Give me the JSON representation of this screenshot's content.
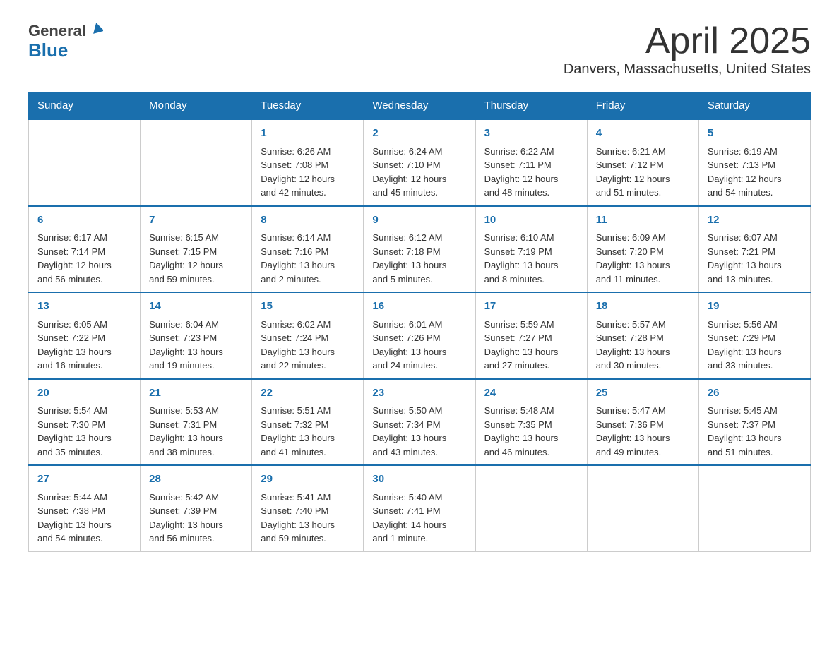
{
  "header": {
    "logo_general": "General",
    "logo_blue": "Blue",
    "title": "April 2025",
    "subtitle": "Danvers, Massachusetts, United States"
  },
  "days_of_week": [
    "Sunday",
    "Monday",
    "Tuesday",
    "Wednesday",
    "Thursday",
    "Friday",
    "Saturday"
  ],
  "weeks": [
    [
      {
        "day": "",
        "info": ""
      },
      {
        "day": "",
        "info": ""
      },
      {
        "day": "1",
        "info": "Sunrise: 6:26 AM\nSunset: 7:08 PM\nDaylight: 12 hours\nand 42 minutes."
      },
      {
        "day": "2",
        "info": "Sunrise: 6:24 AM\nSunset: 7:10 PM\nDaylight: 12 hours\nand 45 minutes."
      },
      {
        "day": "3",
        "info": "Sunrise: 6:22 AM\nSunset: 7:11 PM\nDaylight: 12 hours\nand 48 minutes."
      },
      {
        "day": "4",
        "info": "Sunrise: 6:21 AM\nSunset: 7:12 PM\nDaylight: 12 hours\nand 51 minutes."
      },
      {
        "day": "5",
        "info": "Sunrise: 6:19 AM\nSunset: 7:13 PM\nDaylight: 12 hours\nand 54 minutes."
      }
    ],
    [
      {
        "day": "6",
        "info": "Sunrise: 6:17 AM\nSunset: 7:14 PM\nDaylight: 12 hours\nand 56 minutes."
      },
      {
        "day": "7",
        "info": "Sunrise: 6:15 AM\nSunset: 7:15 PM\nDaylight: 12 hours\nand 59 minutes."
      },
      {
        "day": "8",
        "info": "Sunrise: 6:14 AM\nSunset: 7:16 PM\nDaylight: 13 hours\nand 2 minutes."
      },
      {
        "day": "9",
        "info": "Sunrise: 6:12 AM\nSunset: 7:18 PM\nDaylight: 13 hours\nand 5 minutes."
      },
      {
        "day": "10",
        "info": "Sunrise: 6:10 AM\nSunset: 7:19 PM\nDaylight: 13 hours\nand 8 minutes."
      },
      {
        "day": "11",
        "info": "Sunrise: 6:09 AM\nSunset: 7:20 PM\nDaylight: 13 hours\nand 11 minutes."
      },
      {
        "day": "12",
        "info": "Sunrise: 6:07 AM\nSunset: 7:21 PM\nDaylight: 13 hours\nand 13 minutes."
      }
    ],
    [
      {
        "day": "13",
        "info": "Sunrise: 6:05 AM\nSunset: 7:22 PM\nDaylight: 13 hours\nand 16 minutes."
      },
      {
        "day": "14",
        "info": "Sunrise: 6:04 AM\nSunset: 7:23 PM\nDaylight: 13 hours\nand 19 minutes."
      },
      {
        "day": "15",
        "info": "Sunrise: 6:02 AM\nSunset: 7:24 PM\nDaylight: 13 hours\nand 22 minutes."
      },
      {
        "day": "16",
        "info": "Sunrise: 6:01 AM\nSunset: 7:26 PM\nDaylight: 13 hours\nand 24 minutes."
      },
      {
        "day": "17",
        "info": "Sunrise: 5:59 AM\nSunset: 7:27 PM\nDaylight: 13 hours\nand 27 minutes."
      },
      {
        "day": "18",
        "info": "Sunrise: 5:57 AM\nSunset: 7:28 PM\nDaylight: 13 hours\nand 30 minutes."
      },
      {
        "day": "19",
        "info": "Sunrise: 5:56 AM\nSunset: 7:29 PM\nDaylight: 13 hours\nand 33 minutes."
      }
    ],
    [
      {
        "day": "20",
        "info": "Sunrise: 5:54 AM\nSunset: 7:30 PM\nDaylight: 13 hours\nand 35 minutes."
      },
      {
        "day": "21",
        "info": "Sunrise: 5:53 AM\nSunset: 7:31 PM\nDaylight: 13 hours\nand 38 minutes."
      },
      {
        "day": "22",
        "info": "Sunrise: 5:51 AM\nSunset: 7:32 PM\nDaylight: 13 hours\nand 41 minutes."
      },
      {
        "day": "23",
        "info": "Sunrise: 5:50 AM\nSunset: 7:34 PM\nDaylight: 13 hours\nand 43 minutes."
      },
      {
        "day": "24",
        "info": "Sunrise: 5:48 AM\nSunset: 7:35 PM\nDaylight: 13 hours\nand 46 minutes."
      },
      {
        "day": "25",
        "info": "Sunrise: 5:47 AM\nSunset: 7:36 PM\nDaylight: 13 hours\nand 49 minutes."
      },
      {
        "day": "26",
        "info": "Sunrise: 5:45 AM\nSunset: 7:37 PM\nDaylight: 13 hours\nand 51 minutes."
      }
    ],
    [
      {
        "day": "27",
        "info": "Sunrise: 5:44 AM\nSunset: 7:38 PM\nDaylight: 13 hours\nand 54 minutes."
      },
      {
        "day": "28",
        "info": "Sunrise: 5:42 AM\nSunset: 7:39 PM\nDaylight: 13 hours\nand 56 minutes."
      },
      {
        "day": "29",
        "info": "Sunrise: 5:41 AM\nSunset: 7:40 PM\nDaylight: 13 hours\nand 59 minutes."
      },
      {
        "day": "30",
        "info": "Sunrise: 5:40 AM\nSunset: 7:41 PM\nDaylight: 14 hours\nand 1 minute."
      },
      {
        "day": "",
        "info": ""
      },
      {
        "day": "",
        "info": ""
      },
      {
        "day": "",
        "info": ""
      }
    ]
  ]
}
